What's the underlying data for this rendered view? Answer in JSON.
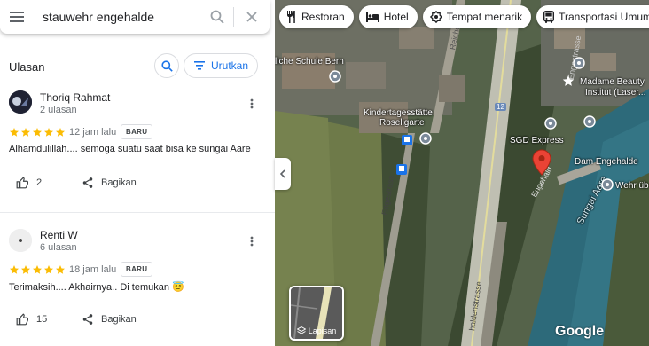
{
  "search": {
    "query": "stauwehr engehalde"
  },
  "reviews_section": {
    "title": "Ulasan",
    "sort_label": "Urutkan"
  },
  "reviews": [
    {
      "name": "Thoriq Rahmat",
      "count": "2 ulasan",
      "rating": 5,
      "time": "12 jam lalu",
      "badge": "BARU",
      "text": "Alhamdulillah.... semoga suatu saat bisa ke sungai Aare",
      "likes": "2",
      "share": "Bagikan"
    },
    {
      "name": "Renti W",
      "count": "6 ulasan",
      "rating": 5,
      "time": "18 jam lalu",
      "badge": "BARU",
      "text": "Terimaksih.... Akhairnya.. Di temukan 😇",
      "likes": "15",
      "share": "Bagikan"
    }
  ],
  "map": {
    "chips": [
      {
        "label": "Restoran",
        "icon": "fork-knife-icon"
      },
      {
        "label": "Hotel",
        "icon": "bed-icon"
      },
      {
        "label": "Tempat menarik",
        "icon": "camera-icon"
      },
      {
        "label": "Transportasi Umum",
        "icon": "bus-icon"
      }
    ],
    "places": {
      "school": "liche Schule Bern",
      "kita": "Kindertagesstätte",
      "kita2": "Roseligarte",
      "sgd": "SGD Express",
      "madame": "Madame Beauty",
      "madame2": "Institut (Laser...",
      "dam": "Dam Engehalde",
      "wehr": "Wehr üb",
      "aare": "Sungai Aare"
    },
    "streets": {
      "reichenbach": "Reichenba",
      "engestrasse": "Engestrass",
      "engehalde": "Engehald",
      "engehaldenstrasse": "haldenstrasse",
      "engestrasse2": "Engestrasse",
      "route": "12"
    },
    "layers_label": "Lapisan",
    "logo": "Google"
  },
  "colors": {
    "star": "#fbbc04",
    "accent": "#1a73e8",
    "pin": "#ea4335"
  }
}
